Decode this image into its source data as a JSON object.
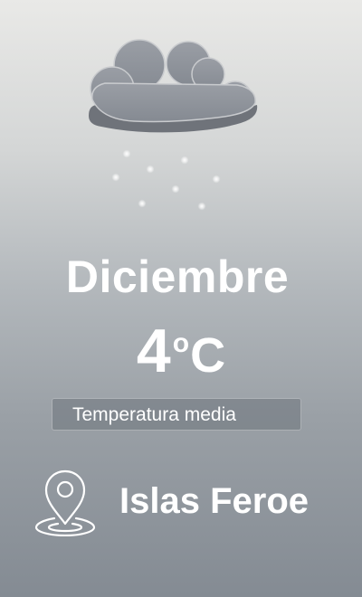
{
  "weather": {
    "icon": "snow-cloud-icon",
    "month": "Diciembre",
    "temperature": "4",
    "degree_symbol": "o",
    "unit": "C",
    "caption": "Temperatura media"
  },
  "location": {
    "icon": "location-pin-icon",
    "name": "Islas Feroe"
  },
  "colors": {
    "text": "#ffffff",
    "cloud": "#8d9199",
    "caption_box": "#6e747c"
  }
}
